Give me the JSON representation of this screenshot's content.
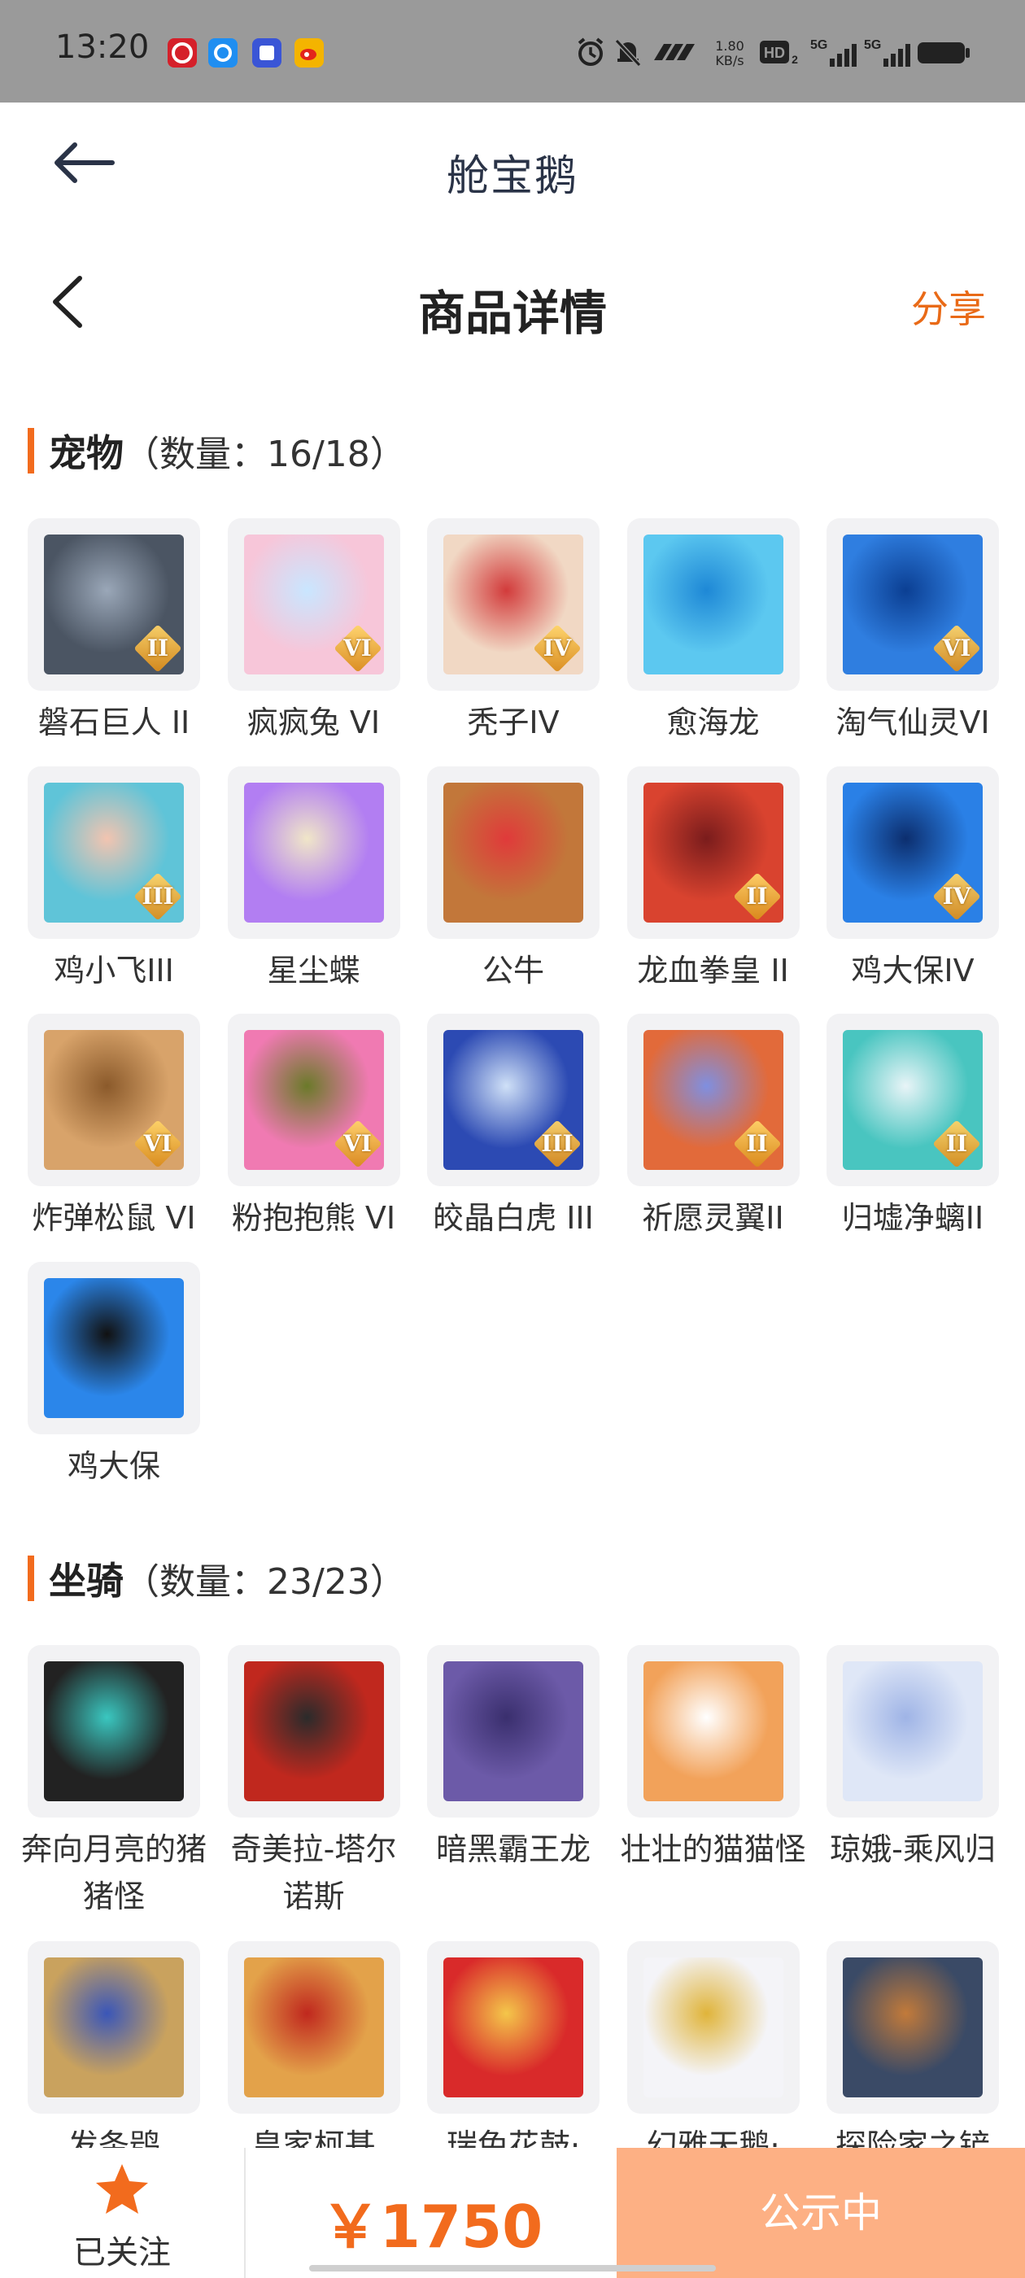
{
  "status_bar": {
    "time": "13:20",
    "net_speed_value": "1.80",
    "net_speed_unit": "KB/s",
    "notification_apps": [
      "netease-music-icon",
      "browser-icon",
      "tieba-icon",
      "weibo-icon"
    ]
  },
  "app_header": {
    "title": "舱宝鹅"
  },
  "page_header": {
    "title": "商品详情",
    "share_label": "分享"
  },
  "pets": {
    "name": "宠物",
    "count_label": "（数量：16/18）",
    "items": [
      {
        "label": "磐石巨人 II",
        "badge": "II",
        "color": "#4b5563",
        "color2": "#9aa7b8"
      },
      {
        "label": "疯疯兔 VI",
        "badge": "VI",
        "color": "#f7c6d9",
        "color2": "#c9e6ff"
      },
      {
        "label": "秃子IV",
        "badge": "IV",
        "color": "#f1d8c4",
        "color2": "#d23b3b"
      },
      {
        "label": "愈海龙",
        "badge": "",
        "color": "#5cc8f0",
        "color2": "#1e88d6"
      },
      {
        "label": "淘气仙灵VI",
        "badge": "VI",
        "color": "#2f7ee0",
        "color2": "#0b3f93"
      },
      {
        "label": "鸡小飞III",
        "badge": "III",
        "color": "#5fc4d8",
        "color2": "#f2c4b0"
      },
      {
        "label": "星尘蝶",
        "badge": "",
        "color": "#b27ef2",
        "color2": "#f0e6c8"
      },
      {
        "label": "公牛",
        "badge": "",
        "color": "#c2773a",
        "color2": "#e03a3a"
      },
      {
        "label": "龙血拳皇 II",
        "badge": "II",
        "color": "#d9432f",
        "color2": "#7a1c1c"
      },
      {
        "label": "鸡大保IV",
        "badge": "IV",
        "color": "#2a80e6",
        "color2": "#0c2e6e"
      },
      {
        "label": "炸弹松鼠 VI",
        "badge": "VI",
        "color": "#d8a36a",
        "color2": "#8b5a2b"
      },
      {
        "label": "粉抱抱熊 VI",
        "badge": "VI",
        "color": "#f07ab2",
        "color2": "#6b7a2a"
      },
      {
        "label": "皎晶白虎 III",
        "badge": "III",
        "color": "#2c4ab3",
        "color2": "#cfe0f7"
      },
      {
        "label": "祈愿灵翼II",
        "badge": "II",
        "color": "#e26a3a",
        "color2": "#7f8fe0"
      },
      {
        "label": "归墟净螭II",
        "badge": "II",
        "color": "#49c5c0",
        "color2": "#e8f4f7"
      },
      {
        "label": "鸡大保",
        "badge": "",
        "color": "#2b86ea",
        "color2": "#111111"
      }
    ]
  },
  "mounts": {
    "name": "坐骑",
    "count_label": "（数量：23/23）",
    "items": [
      {
        "label": "奔向月亮的猪猪怪",
        "color": "#222222",
        "color2": "#3ac7c0"
      },
      {
        "label": "奇美拉-塔尔诺斯",
        "color": "#c0281e",
        "color2": "#2b2b2b"
      },
      {
        "label": "暗黑霸王龙",
        "color": "#6c5aa8",
        "color2": "#3a2f6e"
      },
      {
        "label": "壮壮的猫猫怪",
        "color": "#f2a25a",
        "color2": "#ffffff"
      },
      {
        "label": "琼娥-乘风归",
        "color": "#dfe7f7",
        "color2": "#9fb4e6"
      },
      {
        "label": "发条鸮",
        "color": "#c9a25e",
        "color2": "#3a56b8"
      },
      {
        "label": "皇家柯基",
        "color": "#e3a24a",
        "color2": "#c0281e"
      },
      {
        "label": "瑞兔花鼓·",
        "color": "#d92a2a",
        "color2": "#f4c64a"
      },
      {
        "label": "幻雅天鹅·",
        "color": "#f4f4f8",
        "color2": "#e0b43a"
      },
      {
        "label": "探险家之铲",
        "color": "#3a4a66",
        "color2": "#c27a3a"
      }
    ]
  },
  "bottom_bar": {
    "follow_label": "已关注",
    "price": "￥1750",
    "status_label": "公示中"
  }
}
